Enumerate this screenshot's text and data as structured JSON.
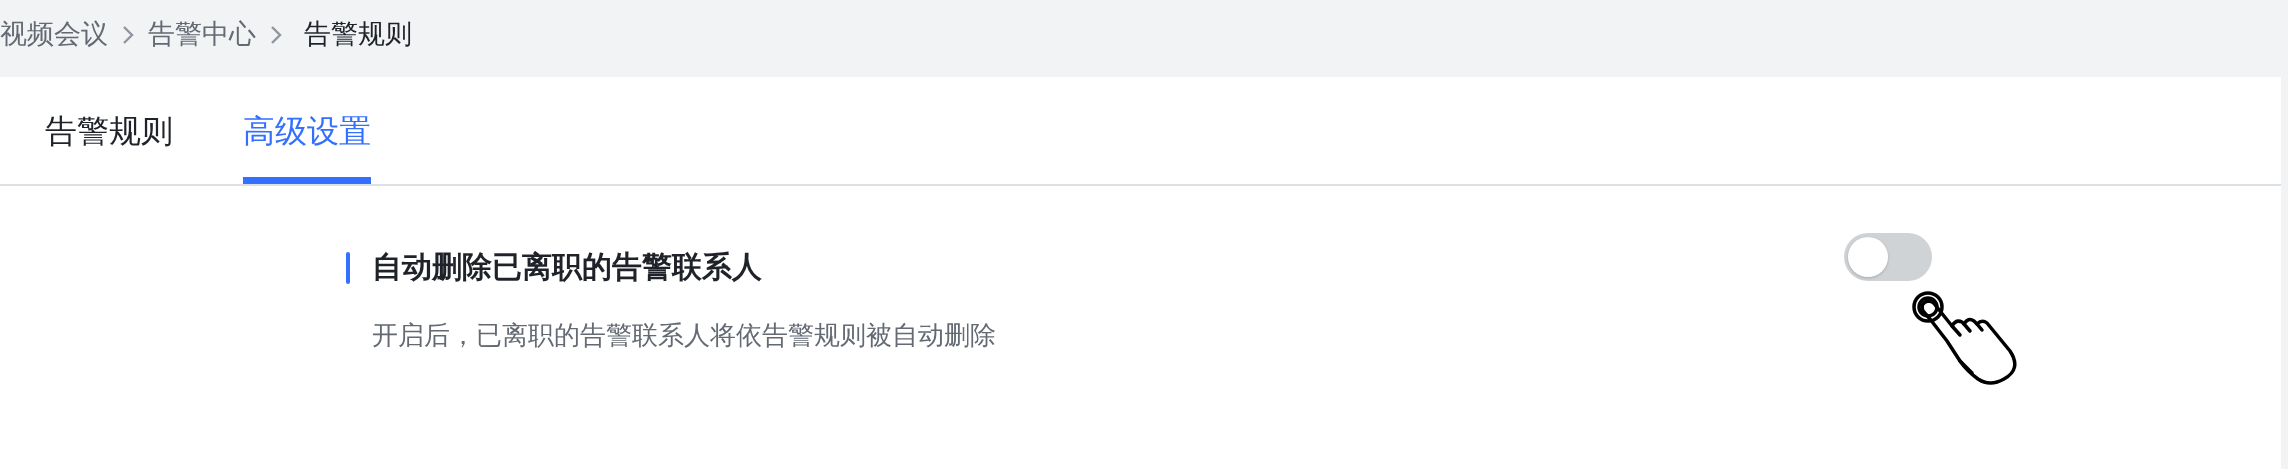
{
  "breadcrumb": [
    {
      "label": "视频会议",
      "current": false
    },
    {
      "label": "告警中心",
      "current": false
    },
    {
      "label": "告警规则",
      "current": true
    }
  ],
  "tabs": [
    {
      "label": "告警规则",
      "selected": false
    },
    {
      "label": "高级设置",
      "selected": true
    }
  ],
  "setting": {
    "title": "自动删除已离职的告警联系人",
    "description": "开启后，已离职的告警联系人将依告警规则被自动删除",
    "on": false
  }
}
